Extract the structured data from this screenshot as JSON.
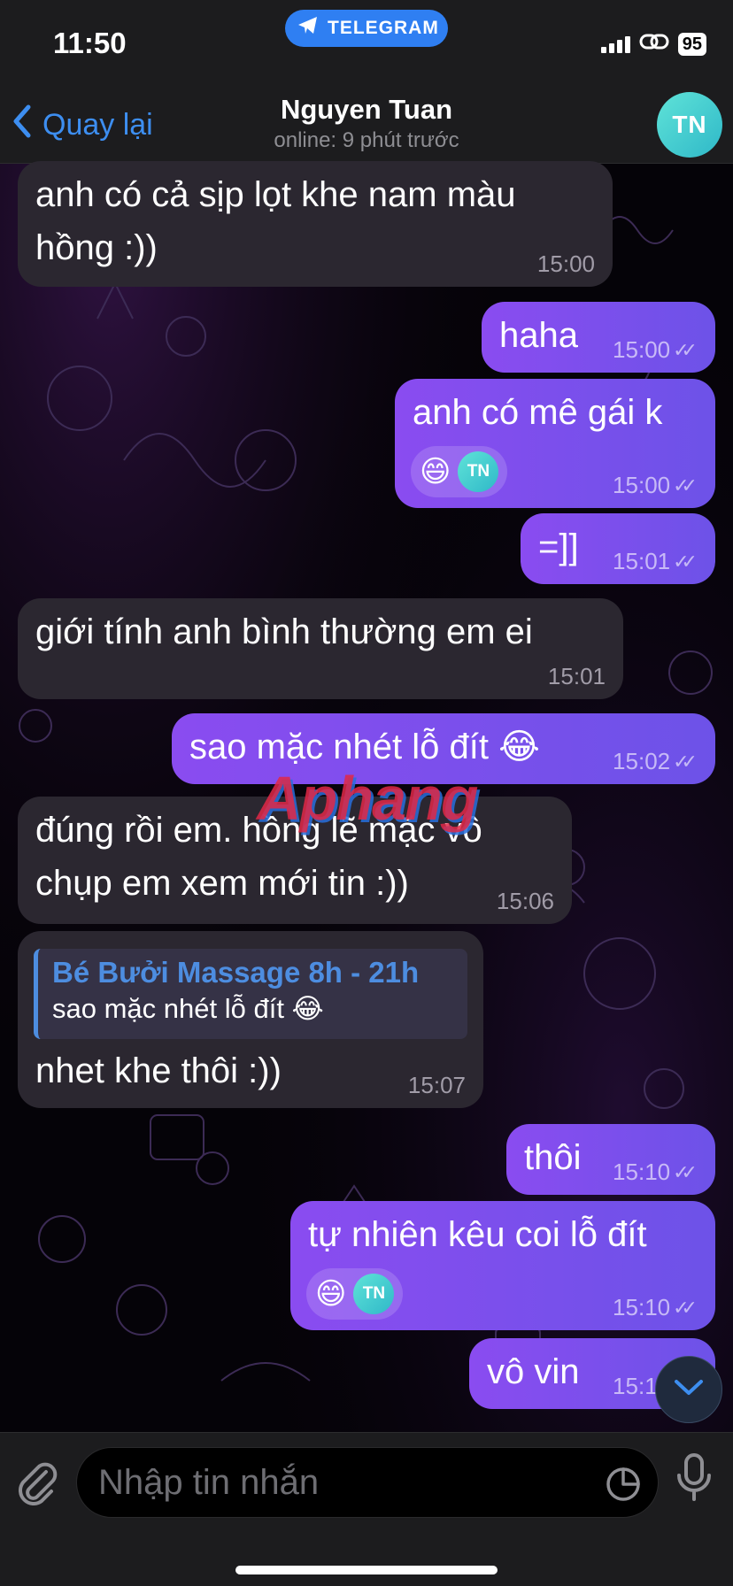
{
  "status_bar": {
    "time": "11:50",
    "battery": "95",
    "pill_label": "TELEGRAM"
  },
  "header": {
    "back_label": "Quay lại",
    "contact_name": "Nguyen Tuan",
    "status": "online: 9 phút trước",
    "avatar_initials": "TN"
  },
  "messages": [
    {
      "direction": "in",
      "lines": [
        "anh có cả sịp lọt khe nam màu",
        "hồng :))"
      ],
      "time": "15:00"
    },
    {
      "direction": "out",
      "lines": [
        "haha"
      ],
      "time": "15:00",
      "read": true
    },
    {
      "direction": "out",
      "lines": [
        "anh có mê gái k"
      ],
      "time": "15:00",
      "read": true,
      "reaction": {
        "emoji": "😄",
        "by": "TN"
      }
    },
    {
      "direction": "out",
      "lines": [
        "=]]"
      ],
      "time": "15:01",
      "read": true
    },
    {
      "direction": "in",
      "lines": [
        "giới tính anh  bình thường em ei"
      ],
      "time": "15:01"
    },
    {
      "direction": "out",
      "lines": [
        "sao mặc nhét lỗ đít 😂"
      ],
      "time": "15:02",
      "read": true
    },
    {
      "direction": "in",
      "lines": [
        "đúng rồi em. hồng lẽ mặc vô",
        "chụp em xem mới tin :))"
      ],
      "time": "15:06"
    },
    {
      "direction": "in",
      "reply_to": {
        "name": "Bé Bưởi Massage 8h - 21h",
        "text": "sao mặc nhét lỗ đít 😂"
      },
      "lines": [
        "nhet khe thôi :))"
      ],
      "time": "15:07"
    },
    {
      "direction": "out",
      "lines": [
        "thôi"
      ],
      "time": "15:10",
      "read": true
    },
    {
      "direction": "out",
      "lines": [
        "tự nhiên kêu coi lỗ đít"
      ],
      "time": "15:10",
      "read": true,
      "reaction": {
        "emoji": "😄",
        "by": "TN"
      }
    },
    {
      "direction": "out",
      "lines": [
        "vô vin"
      ],
      "time": "15:10",
      "read": true
    }
  ],
  "watermark": "Aphang",
  "composer": {
    "placeholder": "Nhập tin nhắn"
  },
  "icons": {
    "back": "chevron-left-icon",
    "telegram": "paper-plane-icon",
    "attach": "paperclip-icon",
    "sticker": "sticker-icon",
    "mic": "microphone-icon",
    "scroll": "chevron-down-icon",
    "read": "double-check-icon"
  },
  "colors": {
    "accent": "#3d8ef0",
    "outgoing_bubble": "#7b50ec",
    "incoming_bubble": "#2b2730",
    "background": "#000000",
    "bar": "#1c1c1e"
  }
}
